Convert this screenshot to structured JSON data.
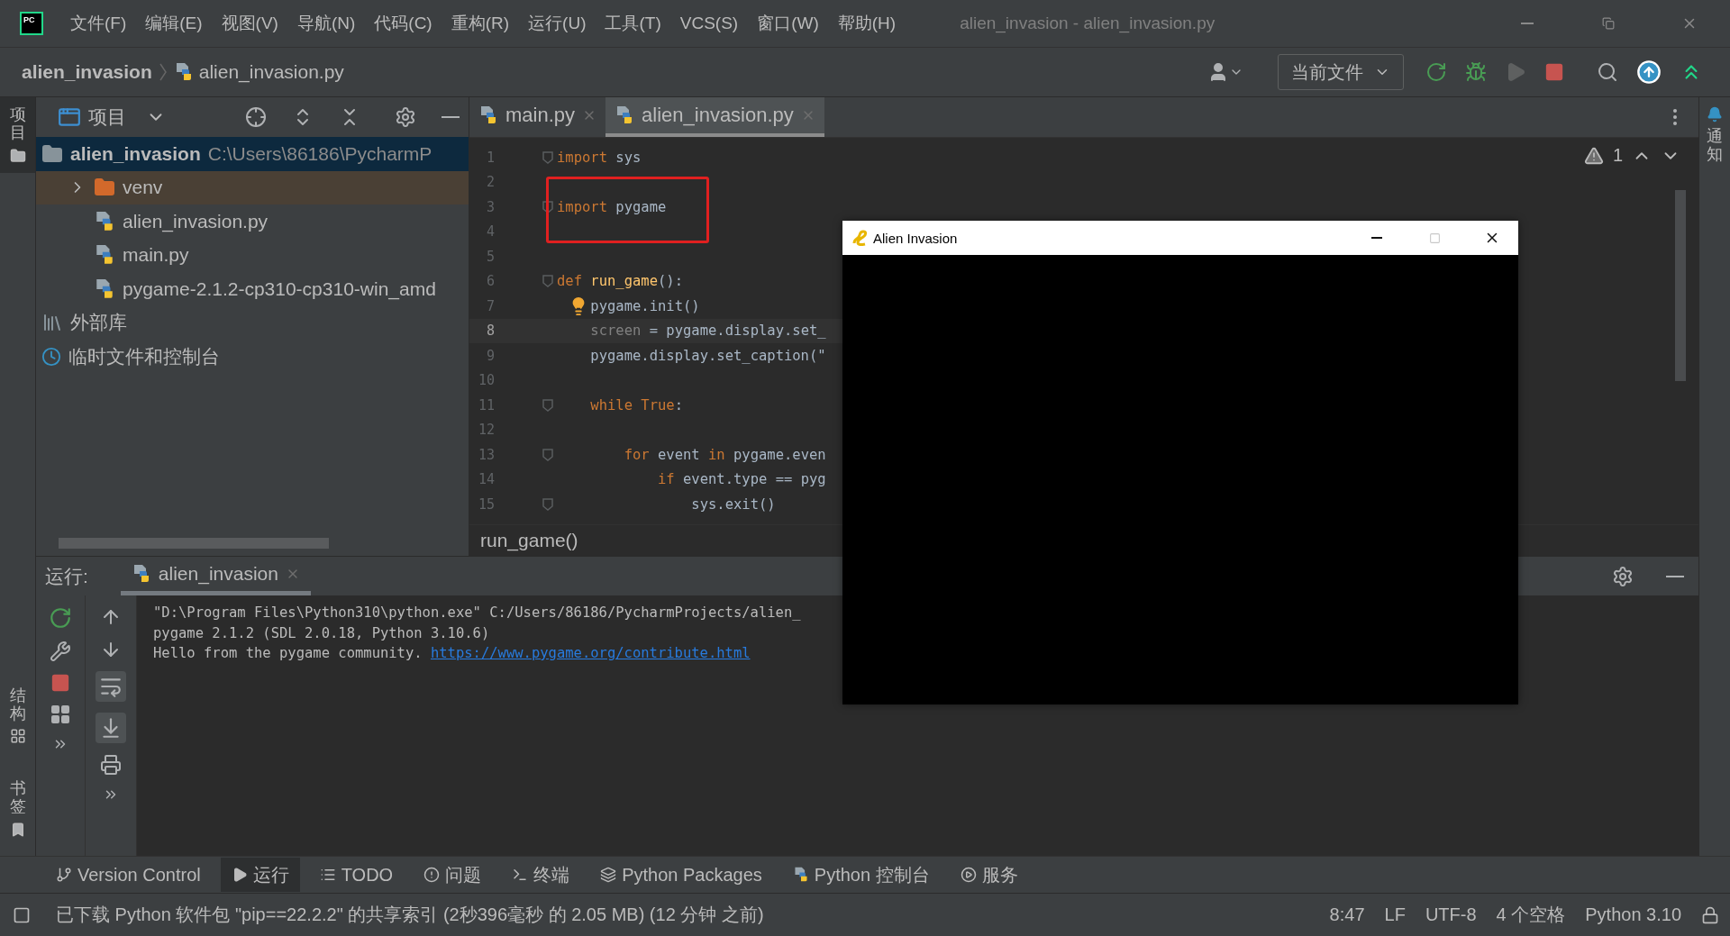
{
  "title_bar": {
    "menus": [
      "文件(F)",
      "编辑(E)",
      "视图(V)",
      "导航(N)",
      "代码(C)",
      "重构(R)",
      "运行(U)",
      "工具(T)",
      "VCS(S)",
      "窗口(W)",
      "帮助(H)"
    ],
    "title": "alien_invasion - alien_invasion.py",
    "logo": "PC"
  },
  "nav_bar": {
    "project": "alien_invasion",
    "file": "alien_invasion.py",
    "run_config": "当前文件"
  },
  "left_stripe": {
    "top_tabs": [
      {
        "label": "项目",
        "selected": true
      }
    ],
    "bottom_tabs": [
      {
        "label": "结构",
        "selected": false
      },
      {
        "label": "书签",
        "selected": false
      }
    ]
  },
  "right_stripe": {
    "tabs": [
      {
        "label": "通知",
        "selected": false
      }
    ]
  },
  "project_panel": {
    "title": "项目",
    "tree": [
      {
        "name": "alien_invasion",
        "path": "C:\\Users\\86186\\PycharmP",
        "kind": "folder",
        "selected": true,
        "children": [
          {
            "name": "venv",
            "kind": "excluded",
            "selected": false,
            "expanded": false
          },
          {
            "name": "alien_invasion.py",
            "kind": "python",
            "selected": false
          },
          {
            "name": "main.py",
            "kind": "python",
            "selected": false
          },
          {
            "name": "pygame-2.1.2-cp310-cp310-win_amd",
            "kind": "python",
            "selected": false
          }
        ]
      },
      {
        "name": "外部库",
        "kind": "library",
        "selected": false
      },
      {
        "name": "临时文件和控制台",
        "kind": "scratch",
        "selected": false
      }
    ]
  },
  "editor": {
    "tabs": [
      {
        "label": "main.py",
        "selected": false
      },
      {
        "label": "alien_invasion.py",
        "selected": true
      }
    ],
    "warnings": "1",
    "breadcrumb": "run_game()",
    "lines": [
      {
        "number": "1",
        "fold": true,
        "bulb": false,
        "annotated": false,
        "current": false,
        "tokens": [
          {
            "kind": "kw",
            "text": "import"
          },
          {
            "kind": "text",
            "text": " sys"
          }
        ]
      },
      {
        "number": "2",
        "fold": false,
        "bulb": false,
        "annotated": false,
        "current": false
      },
      {
        "number": "3",
        "fold": true,
        "bulb": false,
        "annotated": true,
        "current": false,
        "tokens": [
          {
            "kind": "kw",
            "text": "import"
          },
          {
            "kind": "text",
            "text": " pygame"
          }
        ]
      },
      {
        "number": "4",
        "fold": false,
        "bulb": false,
        "annotated": false,
        "current": false
      },
      {
        "number": "5",
        "fold": false,
        "bulb": false,
        "annotated": false,
        "current": false
      },
      {
        "number": "6",
        "fold": true,
        "bulb": false,
        "annotated": false,
        "current": false,
        "tokens": [
          {
            "kind": "kw",
            "text": "def "
          },
          {
            "kind": "fn",
            "text": "run_game"
          },
          {
            "kind": "text",
            "text": "():"
          }
        ]
      },
      {
        "number": "7",
        "fold": false,
        "bulb": true,
        "annotated": false,
        "current": false,
        "tokens": [
          {
            "kind": "text",
            "text": "    pygame.init()"
          }
        ]
      },
      {
        "number": "8",
        "fold": false,
        "bulb": false,
        "annotated": false,
        "current": true,
        "tokens": [
          {
            "kind": "dim",
            "text": "    screen"
          },
          {
            "kind": "text",
            "text": " = pygame.display.set_"
          }
        ]
      },
      {
        "number": "9",
        "fold": false,
        "bulb": false,
        "annotated": false,
        "current": false,
        "tokens": [
          {
            "kind": "text",
            "text": "    pygame.display.set_caption(\""
          }
        ]
      },
      {
        "number": "10",
        "fold": false,
        "bulb": false,
        "annotated": false,
        "current": false
      },
      {
        "number": "11",
        "fold": true,
        "bulb": false,
        "annotated": false,
        "current": false,
        "tokens": [
          {
            "kind": "kw",
            "text": "    while True"
          },
          {
            "kind": "text",
            "text": ":"
          }
        ]
      },
      {
        "number": "12",
        "fold": false,
        "bulb": false,
        "annotated": false,
        "current": false
      },
      {
        "number": "13",
        "fold": true,
        "bulb": false,
        "annotated": false,
        "current": false,
        "tokens": [
          {
            "kind": "kw",
            "text": "        for "
          },
          {
            "kind": "text",
            "text": "event "
          },
          {
            "kind": "kw",
            "text": "in "
          },
          {
            "kind": "text",
            "text": "pygame.even"
          }
        ]
      },
      {
        "number": "14",
        "fold": false,
        "bulb": false,
        "annotated": false,
        "current": false,
        "tokens": [
          {
            "kind": "kw",
            "text": "            if "
          },
          {
            "kind": "text",
            "text": "event.type == pyg"
          }
        ]
      },
      {
        "number": "15",
        "fold": true,
        "bulb": false,
        "annotated": false,
        "current": false,
        "tokens": [
          {
            "kind": "text",
            "text": "                sys.exit()"
          }
        ]
      }
    ]
  },
  "run_panel": {
    "label": "运行:",
    "tabs": [
      {
        "label": "alien_invasion",
        "selected": true
      }
    ],
    "output": [
      {
        "text": "\"D:\\Program Files\\Python310\\python.exe\" C:/Users/86186/PycharmProjects/alien_"
      },
      {
        "text": "pygame 2.1.2 (SDL 2.0.18, Python 3.10.6)"
      },
      {
        "text": "Hello from the pygame community. ",
        "link": "https://www.pygame.org/contribute.html"
      }
    ]
  },
  "game_window": {
    "title": "Alien Invasion"
  },
  "tool_windows": [
    {
      "kind": "vcs",
      "label": "Version Control",
      "selected": false
    },
    {
      "kind": "run",
      "label": "运行",
      "selected": true
    },
    {
      "kind": "todo",
      "label": "TODO",
      "selected": false
    },
    {
      "kind": "problems",
      "label": "问题",
      "selected": false
    },
    {
      "kind": "terminal",
      "label": "终端",
      "selected": false
    },
    {
      "kind": "packages",
      "label": "Python Packages",
      "selected": false
    },
    {
      "kind": "console",
      "label": "Python 控制台",
      "selected": false
    },
    {
      "kind": "services",
      "label": "服务",
      "selected": false
    }
  ],
  "status_bar": {
    "message": "已下载 Python 软件包 \"pip==22.2.2\" 的共享索引 (2秒396毫秒 的 2.05 MB) (12 分钟 之前)",
    "items": [
      "8:47",
      "LF",
      "UTF-8",
      "4 个空格",
      "Python 3.10"
    ]
  }
}
